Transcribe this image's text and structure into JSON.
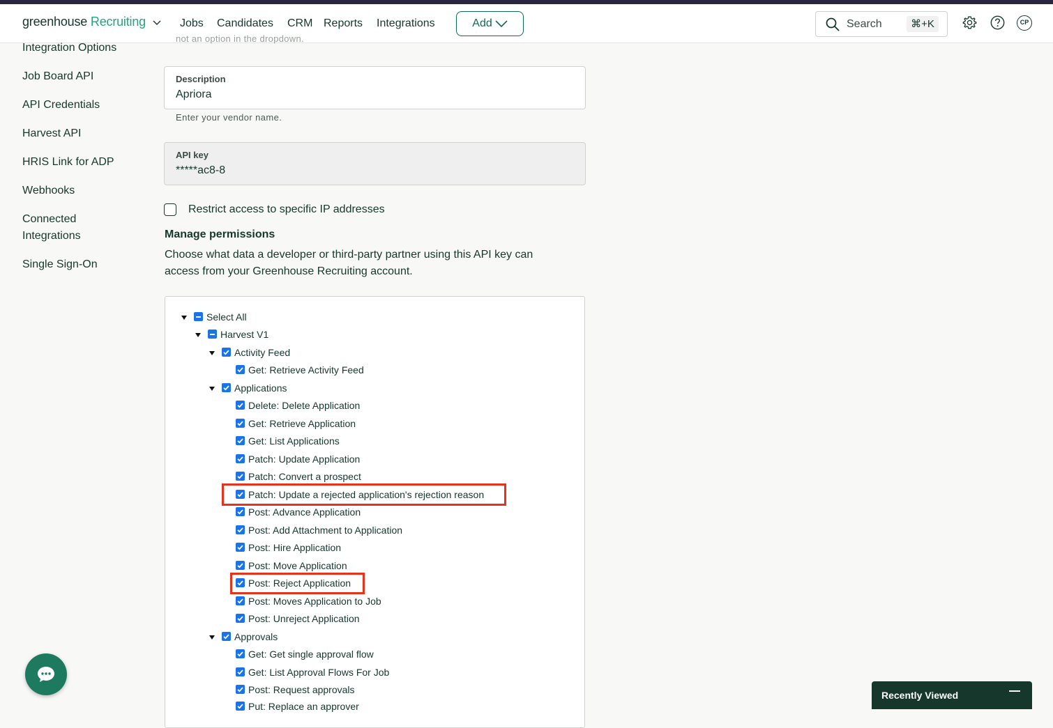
{
  "header": {
    "logo_part1": "greenhouse",
    "logo_part2": "Recruiting",
    "nav": [
      "Jobs",
      "Candidates",
      "CRM",
      "Reports",
      "Integrations"
    ],
    "add_label": "Add",
    "search_placeholder": "Search",
    "search_shortcut": "⌘+K",
    "avatar_initials": "CP"
  },
  "sidebar": {
    "items": [
      "Integration Options",
      "Job Board API",
      "API Credentials",
      "Harvest API",
      "HRIS Link for ADP",
      "Webhooks",
      "Connected",
      "Integrations",
      "Single Sign-On"
    ]
  },
  "form": {
    "faint_text": "not an option in the dropdown.",
    "description_label": "Description",
    "description_value": "Apriora",
    "description_helper": "Enter your vendor name.",
    "api_key_label": "API key",
    "api_key_value": "*****ac8-8",
    "restrict_label": "Restrict access to specific IP addresses",
    "restrict_checked": false,
    "permissions_title": "Manage permissions",
    "permissions_desc_line1": "Choose what data a developer or third-party partner using this API key can",
    "permissions_desc_line2": "access from your Greenhouse Recruiting account."
  },
  "tree": [
    {
      "label": "Select All",
      "state": "partial"
    },
    {
      "label": "Harvest V1",
      "state": "partial"
    },
    {
      "label": "Activity Feed",
      "state": "checked"
    },
    {
      "label": "Get: Retrieve Activity Feed",
      "state": "checked"
    },
    {
      "label": "Applications",
      "state": "checked"
    },
    {
      "label": "Delete: Delete Application",
      "state": "checked"
    },
    {
      "label": "Get: Retrieve Application",
      "state": "checked"
    },
    {
      "label": "Get: List Applications",
      "state": "checked"
    },
    {
      "label": "Patch: Update Application",
      "state": "checked"
    },
    {
      "label": "Patch: Convert a prospect",
      "state": "checked"
    },
    {
      "label": "Patch: Update a rejected application's rejection reason",
      "state": "checked"
    },
    {
      "label": "Post: Advance Application",
      "state": "checked"
    },
    {
      "label": "Post: Add Attachment to Application",
      "state": "checked"
    },
    {
      "label": "Post: Hire Application",
      "state": "checked"
    },
    {
      "label": "Post: Move Application",
      "state": "checked"
    },
    {
      "label": "Post: Reject Application",
      "state": "checked"
    },
    {
      "label": "Post: Moves Application to Job",
      "state": "checked"
    },
    {
      "label": "Post: Unreject Application",
      "state": "checked"
    },
    {
      "label": "Approvals",
      "state": "checked"
    },
    {
      "label": "Get: Get single approval flow",
      "state": "checked"
    },
    {
      "label": "Get: List Approval Flows For Job",
      "state": "checked"
    },
    {
      "label": "Post: Request approvals",
      "state": "checked"
    },
    {
      "label": "Put: Replace an approver",
      "state": "checked"
    }
  ],
  "highlight_color": "#e8331c",
  "recently_viewed": {
    "title": "Recently Viewed"
  }
}
